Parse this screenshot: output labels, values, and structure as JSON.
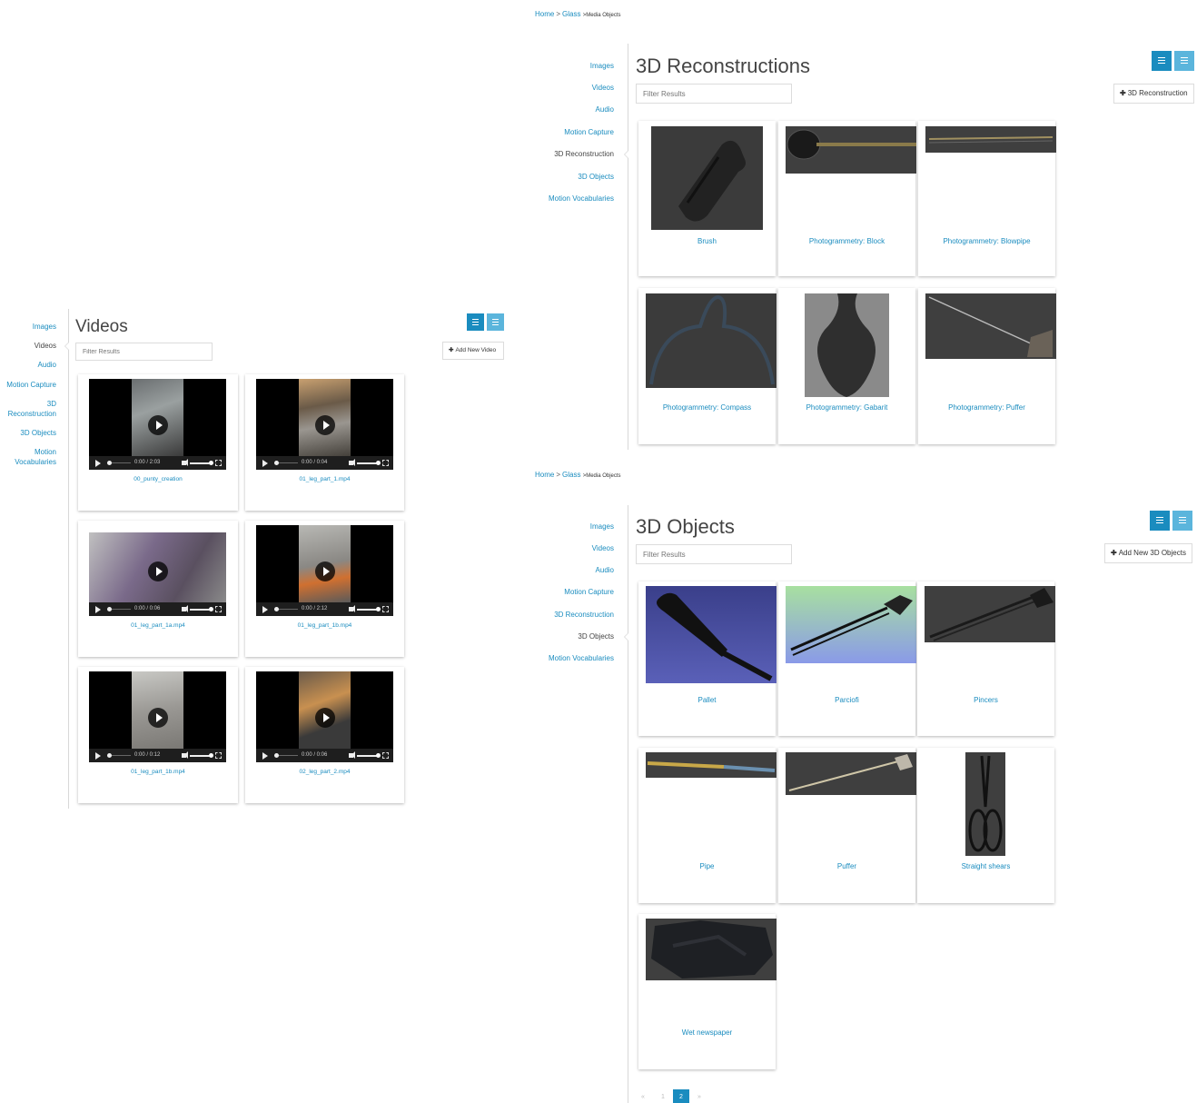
{
  "breadcrumb": {
    "home": "Home",
    "sep": ">",
    "glass": "Glass",
    "current": ">Media Objects"
  },
  "nav": {
    "images": "Images",
    "videos": "Videos",
    "audio": "Audio",
    "motion_capture": "Motion Capture",
    "recon": "3D Reconstruction",
    "recon_l1": "3D",
    "recon_l2": "Reconstruction",
    "objects": "3D Objects",
    "vocab": "Motion Vocabularies",
    "vocab_l1": "Motion",
    "vocab_l2": "Vocabularies"
  },
  "filter_placeholder": "Filter Results",
  "icons": {
    "list": "list-view-icon",
    "grid": "grid-view-icon",
    "plus": "plus-icon",
    "play": "play-icon",
    "volume": "volume-icon",
    "fullscreen": "fullscreen-icon"
  },
  "colors": {
    "accent": "#1a8cbf",
    "accent_light": "#5bb5dc"
  },
  "videos_page": {
    "title": "Videos",
    "add_label": "Add New Video",
    "plus": "✚",
    "items": [
      {
        "name": "00_punty_creation",
        "time": "0:00 / 2:03"
      },
      {
        "name": "01_leg_part_1.mp4",
        "time": "0:00 / 0:04"
      },
      {
        "name": "01_leg_part_1a.mp4",
        "time": "0:00 / 0:06"
      },
      {
        "name": "01_leg_part_1b.mp4",
        "time": "0:00 / 2:12"
      },
      {
        "name": "01_leg_part_1b.mp4",
        "time": "0:00 / 0:12"
      },
      {
        "name": "02_leg_part_2.mp4",
        "time": "0:00 / 0:06"
      }
    ]
  },
  "recon_page": {
    "title": "3D Reconstructions",
    "add_label": "3D Reconstruction",
    "plus": "✚",
    "items": [
      "Brush",
      "Photogrammetry: Block",
      "Photogrammetry: Blowpipe",
      "Photogrammetry: Compass",
      "Photogrammetry: Gabarit",
      "Photogrammetry: Puffer"
    ]
  },
  "objects_page": {
    "title": "3D Objects",
    "add_label": "Add New 3D Objects",
    "plus": "✚",
    "items": [
      "Pallet",
      "Parciofi",
      "Pincers",
      "Pipe",
      "Puffer",
      "Straight shears",
      "Wet newspaper"
    ],
    "pager": {
      "prev": "«",
      "p1": "1",
      "p2": "2",
      "next": "»"
    }
  }
}
